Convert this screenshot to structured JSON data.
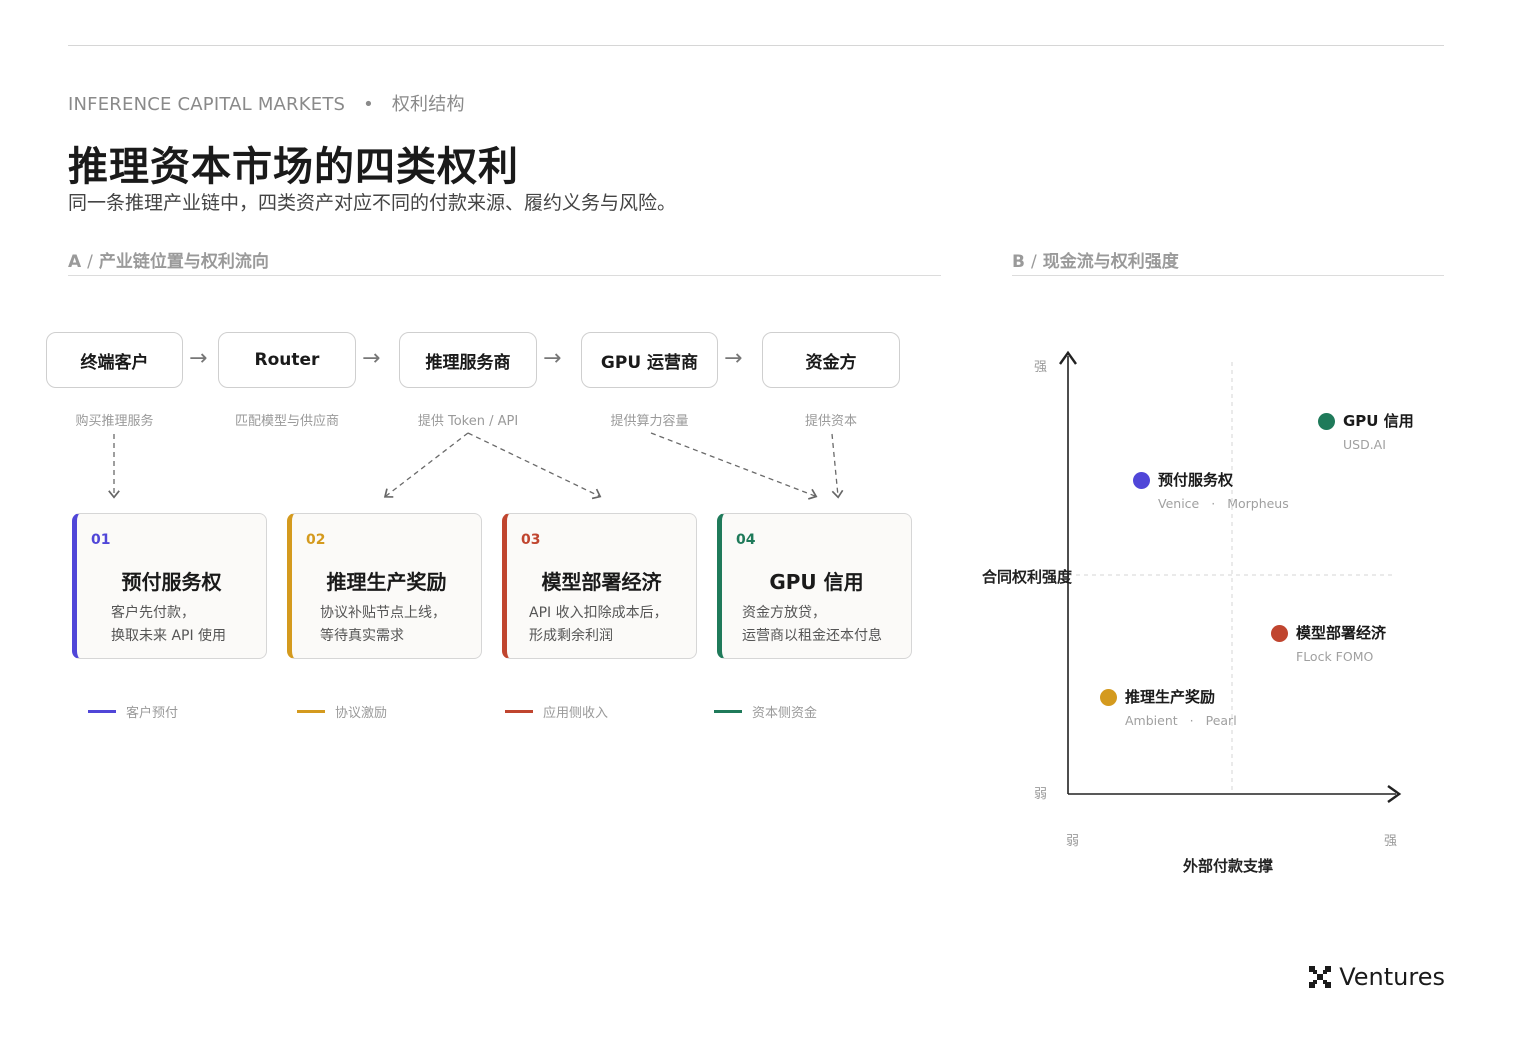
{
  "header": {
    "kicker": "INFERENCE CAPITAL MARKETS",
    "kicker_sep": "•",
    "kicker_tag": "权利结构",
    "title": "推理资本市场的四类权利",
    "subtitle": "同一条推理产业链中，四类资产对应不同的付款来源、履约义务与风险。"
  },
  "section_a": {
    "letter": "A",
    "slash": "/",
    "label": "产业链位置与权利流向"
  },
  "section_b": {
    "letter": "B",
    "slash": "/",
    "label": "现金流与权利强度"
  },
  "flow": {
    "arrow": "→",
    "nodes": [
      {
        "label": "终端客户",
        "caption": "购买推理服务"
      },
      {
        "label": "Router",
        "caption": "匹配模型与供应商"
      },
      {
        "label": "推理服务商",
        "caption": "提供 Token / API"
      },
      {
        "label": "GPU 运营商",
        "caption": "提供算力容量"
      },
      {
        "label": "资金方",
        "caption": "提供资本"
      }
    ]
  },
  "cards": [
    {
      "num": "01",
      "title": "预付服务权",
      "desc1": "客户先付款，",
      "desc2": "换取未来 API 使用",
      "color": "#5046d8"
    },
    {
      "num": "02",
      "title": "推理生产奖励",
      "desc1": "协议补贴节点上线，",
      "desc2": "等待真实需求",
      "color": "#d49a1e"
    },
    {
      "num": "03",
      "title": "模型部署经济",
      "desc1": "API 收入扣除成本后，",
      "desc2": "形成剩余利润",
      "color": "#c0452f"
    },
    {
      "num": "04",
      "title": "GPU 信用",
      "desc1": "资金方放贷，",
      "desc2": "运营商以租金还本付息",
      "color": "#1f7a5a"
    }
  ],
  "legend": [
    {
      "label": "客户预付",
      "color": "#5046d8"
    },
    {
      "label": "协议激励",
      "color": "#d49a1e"
    },
    {
      "label": "应用侧收入",
      "color": "#c0452f"
    },
    {
      "label": "资本侧资金",
      "color": "#1f7a5a"
    }
  ],
  "quadrant": {
    "y_title": "合同权利强度",
    "x_title": "外部付款支撑",
    "y_high": "强",
    "y_low": "弱",
    "x_low": "弱",
    "x_high": "强",
    "points": [
      {
        "title": "GPU 信用",
        "sub": "USD.AI",
        "color": "#1f7a5a"
      },
      {
        "title": "预付服务权",
        "sub1": "Venice",
        "sep": "·",
        "sub2": "Morpheus",
        "color": "#5046d8"
      },
      {
        "title": "模型部署经济",
        "sub": "FLock FOMO",
        "color": "#c0452f"
      },
      {
        "title": "推理生产奖励",
        "sub1": "Ambient",
        "sep": "·",
        "sub2": "Pearl",
        "color": "#d49a1e"
      }
    ]
  },
  "brand": {
    "name": "Ventures",
    "logo": "x-grid-logo"
  }
}
